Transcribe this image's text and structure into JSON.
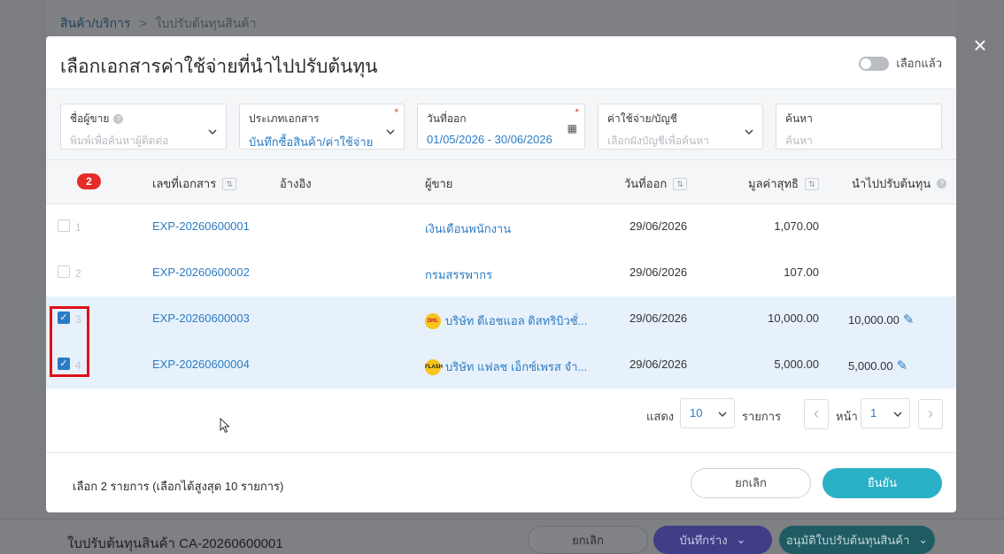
{
  "background": {
    "breadcrumb": {
      "parent": "สินค้า/บริการ",
      "separator": ">",
      "current": "ใบปรับต้นทุนสินค้า"
    },
    "footer_title": "ใบปรับต้นทุนสินค้า CA-20260600001",
    "buttons": {
      "cancel": "ยกเลิก",
      "draft": "บันทึกร่าง",
      "approve": "อนุมัติใบปรับต้นทุนสินค้า"
    }
  },
  "close_icon": "×",
  "modal": {
    "title": "เลือกเอกสารค่าใช้จ่ายที่นำไปปรับต้นทุน",
    "toggle_label": "เลือกแล้ว",
    "filters": {
      "vendor": {
        "label": "ชื่อผู้ขาย",
        "placeholder": "พิมพ์เพื่อค้นหาผู้ติดต่อ"
      },
      "doc_type": {
        "label": "ประเภทเอกสาร",
        "value": "บันทึกซื้อสินค้า/ค่าใช้จ่าย",
        "required": "*"
      },
      "issue_date": {
        "label": "วันที่ออก",
        "value": "01/05/2026 - 30/06/2026",
        "required": "*"
      },
      "account": {
        "label": "ค่าใช้จ่าย/บัญชี",
        "placeholder": "เลือกผังบัญชีเพื่อค้นหา"
      },
      "search": {
        "label": "ค้นหา",
        "placeholder": "ค้นหา"
      }
    },
    "table": {
      "selected_count": "2",
      "headers": {
        "doc_no": "เลขที่เอกสาร",
        "reference": "อ้างอิง",
        "vendor": "ผู้ขาย",
        "issue_date": "วันที่ออก",
        "net_value": "มูลค่าสุทธิ",
        "adjust": "นำไปปรับต้นทุน"
      },
      "rows": [
        {
          "idx": "1",
          "doc_no": "EXP-20260600001",
          "vendor": "เงินเดือนพนักงาน",
          "date": "29/06/2026",
          "net": "1,070.00",
          "adjust": "",
          "checked": false,
          "logo": ""
        },
        {
          "idx": "2",
          "doc_no": "EXP-20260600002",
          "vendor": "กรมสรรพากร",
          "date": "29/06/2026",
          "net": "107.00",
          "adjust": "",
          "checked": false,
          "logo": ""
        },
        {
          "idx": "3",
          "doc_no": "EXP-20260600003",
          "vendor": "บริษัท ดีเอชแอล ดิสทริบิวชั่...",
          "date": "29/06/2026",
          "net": "10,000.00",
          "adjust": "10,000.00",
          "checked": true,
          "logo": "DHL"
        },
        {
          "idx": "4",
          "doc_no": "EXP-20260600004",
          "vendor": "บริษัท แฟลช เอ็กซ์เพรส จำ...",
          "date": "29/06/2026",
          "net": "5,000.00",
          "adjust": "5,000.00",
          "checked": true,
          "logo": "FLASH"
        }
      ]
    },
    "pagination": {
      "show_label": "แสดง",
      "page_size": "10",
      "items_label": "รายการ",
      "page_label": "หน้า",
      "page": "1"
    },
    "footer": {
      "note": "เลือก 2 รายการ (เลือกได้สูงสุด 10 รายการ)",
      "cancel": "ยกเลิก",
      "confirm": "ยืนยัน"
    }
  },
  "colors": {
    "accent": "#2b7bc4",
    "confirm": "#2ab0c7",
    "badge": "#e52d27",
    "highlight": "#e0101a",
    "selected_row": "#e7f1fb"
  }
}
